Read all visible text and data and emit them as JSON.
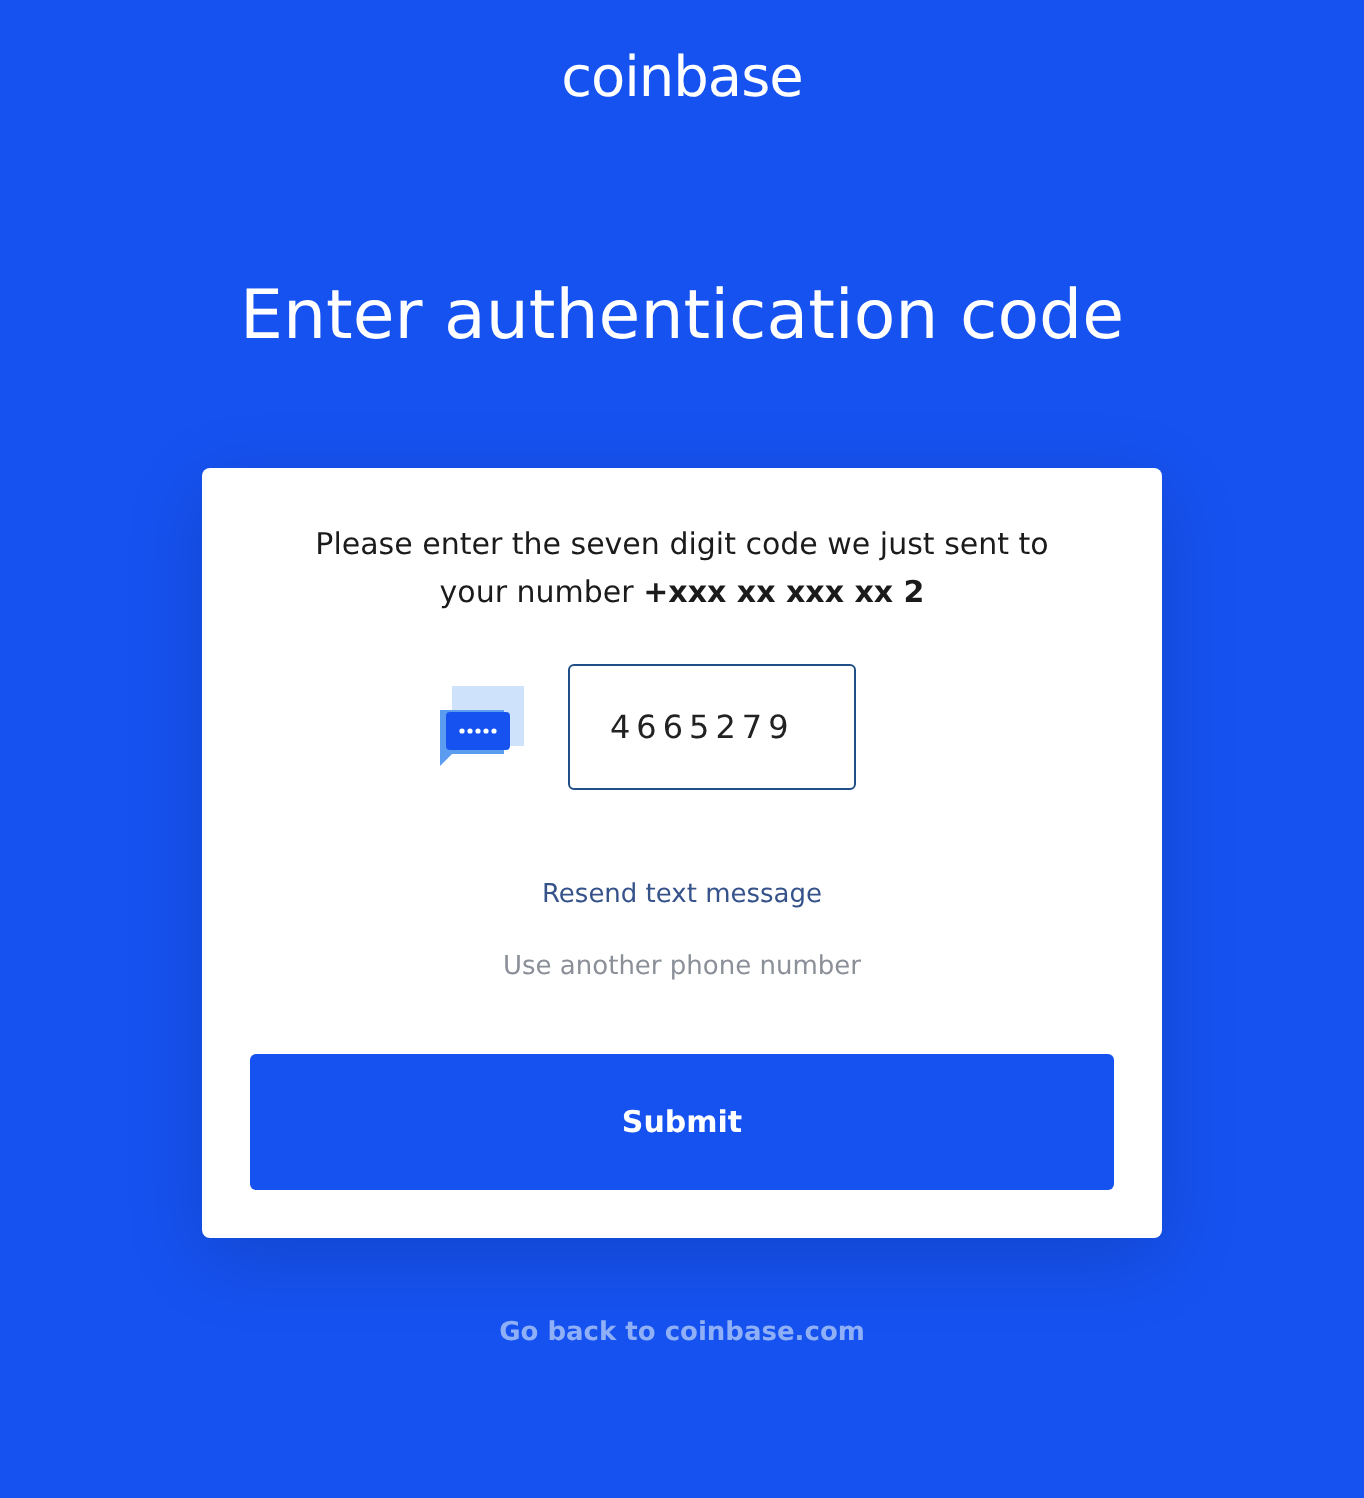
{
  "logo": "coinbase",
  "title": "Enter authentication code",
  "card": {
    "instructions": "Please enter the seven digit code we just sent to your number **+xxx xx xxx xx 2**",
    "code_field": {
      "value": "4665279"
    },
    "resend_link": "Resend text message",
    "other_number_link": "Use another phone number",
    "submit_button": "Submit"
  },
  "footer_link": "Go back to coinbase.com"
}
